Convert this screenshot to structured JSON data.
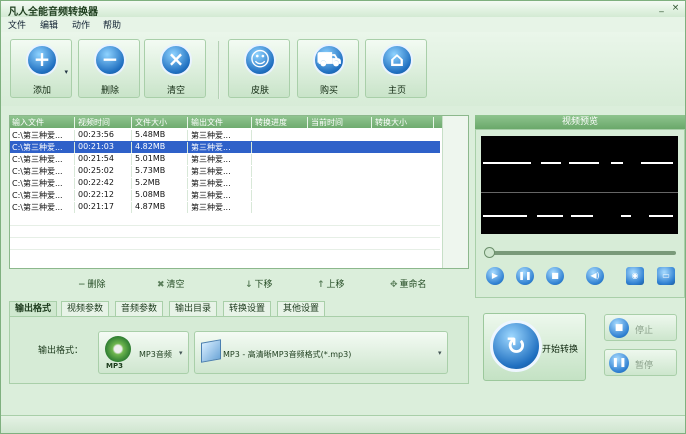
{
  "window": {
    "title": "凡人全能音频转换器",
    "min_icon": "minimize-icon",
    "close_icon": "close-icon",
    "min_glyph": "_",
    "close_glyph": "×"
  },
  "menu": [
    "文件",
    "编辑",
    "动作",
    "帮助"
  ],
  "toolbar": {
    "buttons": [
      {
        "label": "添加",
        "icon": "add-icon",
        "glyph": "+"
      },
      {
        "label": "删除",
        "icon": "remove-icon",
        "glyph": "−"
      },
      {
        "label": "清空",
        "icon": "clear-icon",
        "glyph": "×"
      },
      {
        "label": "皮肤",
        "icon": "smiley-icon",
        "glyph": "☺"
      },
      {
        "label": "购买",
        "icon": "cart-icon",
        "glyph": "⛟"
      },
      {
        "label": "主页",
        "icon": "home-icon",
        "glyph": "⌂"
      }
    ],
    "dropdown_glyph": "▾"
  },
  "table": {
    "columns": [
      "输入文件",
      "视频时间",
      "文件大小",
      "输出文件",
      "转换进度",
      "当前时间",
      "转换大小"
    ],
    "rows": [
      [
        "C:\\第三种爱...",
        "00:23:56",
        "5.48MB",
        "第三种爱..."
      ],
      [
        "C:\\第三种爱...",
        "00:21:03",
        "4.82MB",
        "第三种爱..."
      ],
      [
        "C:\\第三种爱...",
        "00:21:54",
        "5.01MB",
        "第三种爱..."
      ],
      [
        "C:\\第三种爱...",
        "00:25:02",
        "5.73MB",
        "第三种爱..."
      ],
      [
        "C:\\第三种爱...",
        "00:22:42",
        "5.2MB",
        "第三种爱..."
      ],
      [
        "C:\\第三种爱...",
        "00:22:12",
        "5.08MB",
        "第三种爱..."
      ],
      [
        "C:\\第三种爱...",
        "00:21:17",
        "4.87MB",
        "第三种爱..."
      ]
    ],
    "selected_row": 1
  },
  "actions": [
    {
      "label": "删除",
      "glyph": "−"
    },
    {
      "label": "清空",
      "glyph": "✖"
    },
    {
      "label": "下移",
      "glyph": "↓"
    },
    {
      "label": "上移",
      "glyph": "↑"
    },
    {
      "label": "重命名",
      "glyph": "✥"
    }
  ],
  "preview": {
    "title": "视频预览",
    "controls": [
      {
        "name": "play",
        "glyph": "▶"
      },
      {
        "name": "pause",
        "glyph": "❚❚"
      },
      {
        "name": "stop",
        "glyph": "■"
      },
      {
        "name": "volume",
        "glyph": "◀)"
      },
      {
        "name": "snapshot",
        "glyph": "◉"
      },
      {
        "name": "folder",
        "glyph": "▭"
      }
    ]
  },
  "tabs": [
    "输出格式",
    "视频参数",
    "音频参数",
    "输出目录",
    "转换设置",
    "其他设置"
  ],
  "active_tab": 0,
  "output": {
    "label": "输出格式：",
    "category": "MP3音频",
    "category_icon_text": "MP3",
    "format": "MP3 - 高清晰MP3音频格式(*.mp3)",
    "dropdown_glyph": "▾"
  },
  "buttons": {
    "start": "开始转换",
    "start_glyph": "↻",
    "stop": "停止",
    "stop_glyph": "■",
    "pause": "暂停",
    "pause_glyph": "❚❚"
  },
  "colors": {
    "accent": "#2f61c9",
    "panel": "#dbeedb",
    "header": "#6fab6f"
  }
}
